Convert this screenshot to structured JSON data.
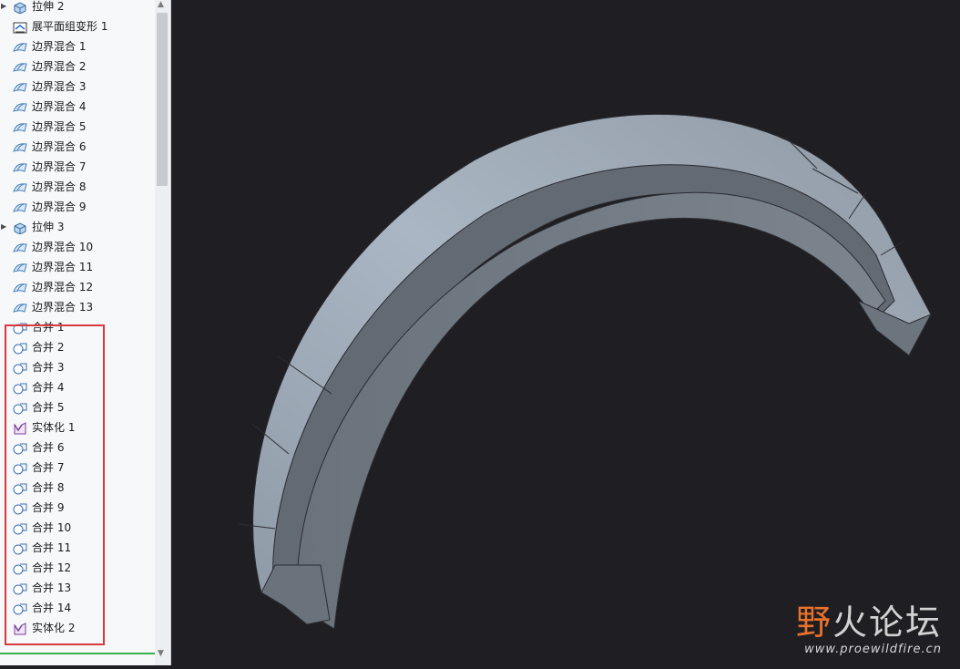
{
  "tree": {
    "items": [
      {
        "label": "拉伸 2",
        "icon": "extrude-icon",
        "expand": true
      },
      {
        "label": "展平面组变形 1",
        "icon": "flatten-quilt-icon",
        "expand": false
      },
      {
        "label": "边界混合 1",
        "icon": "boundary-blend-icon",
        "expand": false
      },
      {
        "label": "边界混合 2",
        "icon": "boundary-blend-icon",
        "expand": false
      },
      {
        "label": "边界混合 3",
        "icon": "boundary-blend-icon",
        "expand": false
      },
      {
        "label": "边界混合 4",
        "icon": "boundary-blend-icon",
        "expand": false
      },
      {
        "label": "边界混合 5",
        "icon": "boundary-blend-icon",
        "expand": false
      },
      {
        "label": "边界混合 6",
        "icon": "boundary-blend-icon",
        "expand": false
      },
      {
        "label": "边界混合 7",
        "icon": "boundary-blend-icon",
        "expand": false
      },
      {
        "label": "边界混合 8",
        "icon": "boundary-blend-icon",
        "expand": false
      },
      {
        "label": "边界混合 9",
        "icon": "boundary-blend-icon",
        "expand": false
      },
      {
        "label": "拉伸 3",
        "icon": "extrude-icon",
        "expand": true
      },
      {
        "label": "边界混合 10",
        "icon": "boundary-blend-icon",
        "expand": false
      },
      {
        "label": "边界混合 11",
        "icon": "boundary-blend-icon",
        "expand": false
      },
      {
        "label": "边界混合 12",
        "icon": "boundary-blend-icon",
        "expand": false
      },
      {
        "label": "边界混合 13",
        "icon": "boundary-blend-icon",
        "expand": false
      },
      {
        "label": "合并 1",
        "icon": "merge-icon",
        "expand": false
      },
      {
        "label": "合并 2",
        "icon": "merge-icon",
        "expand": false
      },
      {
        "label": "合并 3",
        "icon": "merge-icon",
        "expand": false
      },
      {
        "label": "合并 4",
        "icon": "merge-icon",
        "expand": false
      },
      {
        "label": "合并 5",
        "icon": "merge-icon",
        "expand": false
      },
      {
        "label": "实体化 1",
        "icon": "solidify-icon",
        "expand": false
      },
      {
        "label": "合并 6",
        "icon": "merge-icon",
        "expand": false
      },
      {
        "label": "合并 7",
        "icon": "merge-icon",
        "expand": false
      },
      {
        "label": "合并 8",
        "icon": "merge-icon",
        "expand": false
      },
      {
        "label": "合并 9",
        "icon": "merge-icon",
        "expand": false
      },
      {
        "label": "合并 10",
        "icon": "merge-icon",
        "expand": false
      },
      {
        "label": "合并 11",
        "icon": "merge-icon",
        "expand": false
      },
      {
        "label": "合并 12",
        "icon": "merge-icon",
        "expand": false
      },
      {
        "label": "合并 13",
        "icon": "merge-icon",
        "expand": false
      },
      {
        "label": "合并 14",
        "icon": "merge-icon",
        "expand": false
      },
      {
        "label": "实体化 2",
        "icon": "solidify-icon",
        "expand": false
      }
    ]
  },
  "colors": {
    "viewport_bg": "#1f1e23",
    "highlight_box": "#d63a3e",
    "model_face_light": "#a6b1bd",
    "model_face_dark": "#6b727c",
    "watermark_accent": "#e8712b"
  },
  "watermark": {
    "first": "野",
    "rest": "火论坛",
    "url": "www.proewildfire.cn"
  }
}
